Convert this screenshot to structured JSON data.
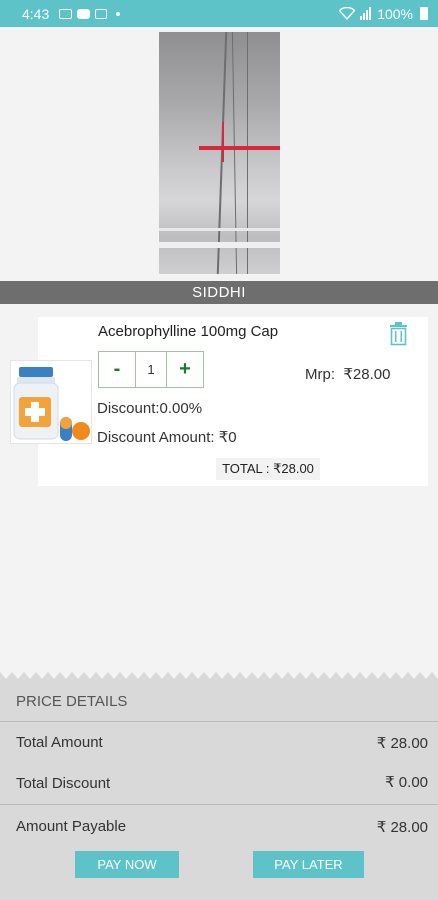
{
  "status_bar": {
    "time": "4:43",
    "battery": "100%"
  },
  "store": {
    "name": "SIDDHI"
  },
  "cart_item": {
    "name": "Acebrophylline 100mg Cap",
    "quantity": "1",
    "minus_label": "-",
    "plus_label": "+",
    "mrp_label": "Mrp:",
    "mrp_value": "₹28.00",
    "discount": "Discount:0.00%",
    "discount_amount": "Discount Amount: ₹0",
    "total": "TOTAL : ₹28.00"
  },
  "price_details": {
    "title": "PRICE DETAILS",
    "rows": [
      {
        "label": "Total Amount",
        "value": "₹ 28.00"
      },
      {
        "label": "Total Discount",
        "value": "₹ 0.00"
      },
      {
        "label": "Amount Payable",
        "value": "₹ 28.00"
      }
    ]
  },
  "actions": {
    "pay_now": "PAY NOW",
    "pay_later": "PAY LATER"
  },
  "colors": {
    "accent": "#5ec3c8",
    "banner": "#6e6e6e",
    "qty_green": "#1e7a2a"
  }
}
